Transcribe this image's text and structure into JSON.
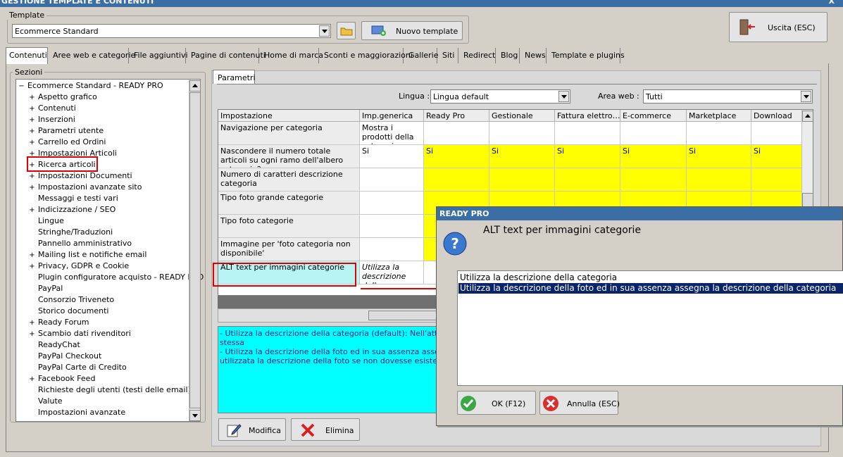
{
  "window": {
    "title": "GESTIONE TEMPLATE E CONTENUTI",
    "close": "X"
  },
  "template": {
    "group_label": "Template",
    "selected": "Ecommerce Standard",
    "new_button": "Nuovo template"
  },
  "exit_button": "Uscita (ESC)",
  "tabs": [
    "Contenuti",
    "Aree web e categorie",
    "File aggiuntivi",
    "Pagine di contenuti",
    "Home di marca",
    "Sconti e maggiorazioni",
    "Gallerie",
    "Siti",
    "Redirect",
    "Blog",
    "News",
    "Template e plugins"
  ],
  "sections": {
    "label": "Sezioni",
    "root": "Ecommerce Standard - READY PRO",
    "items": [
      {
        "label": "Aspetto grafico",
        "exp": "+"
      },
      {
        "label": "Contenuti",
        "exp": "+"
      },
      {
        "label": "Inserzioni",
        "exp": "+"
      },
      {
        "label": "Parametri utente",
        "exp": "+"
      },
      {
        "label": "Carrello ed Ordini",
        "exp": "+"
      },
      {
        "label": "Impostazioni Articoli",
        "exp": "+"
      },
      {
        "label": "Ricerca articoli",
        "exp": "+"
      },
      {
        "label": "Impostazioni Documenti",
        "exp": "+"
      },
      {
        "label": "Impostazioni avanzate sito",
        "exp": "+"
      },
      {
        "label": "Messaggi e testi vari",
        "exp": ""
      },
      {
        "label": "Indicizzazione / SEO",
        "exp": "+"
      },
      {
        "label": "Lingue",
        "exp": ""
      },
      {
        "label": "Stringhe/Traduzioni",
        "exp": ""
      },
      {
        "label": "Pannello amministrativo",
        "exp": ""
      },
      {
        "label": "Mailing list e notifiche email",
        "exp": "+"
      },
      {
        "label": "Privacy, GDPR e Cookie",
        "exp": "+"
      },
      {
        "label": "Plugin configuratore acquisto - READY PRO",
        "exp": ""
      },
      {
        "label": "PayPal",
        "exp": ""
      },
      {
        "label": "Consorzio Triveneto",
        "exp": ""
      },
      {
        "label": "Storico documenti",
        "exp": ""
      },
      {
        "label": "Ready Forum",
        "exp": "+"
      },
      {
        "label": "Scambio dati rivenditori",
        "exp": "+"
      },
      {
        "label": "ReadyChat",
        "exp": ""
      },
      {
        "label": "PayPal Checkout",
        "exp": ""
      },
      {
        "label": "PayPal Carte di Credito",
        "exp": ""
      },
      {
        "label": "Facebook Feed",
        "exp": "+"
      },
      {
        "label": "Richieste degli utenti (testi delle email)",
        "exp": ""
      },
      {
        "label": "Valute",
        "exp": ""
      },
      {
        "label": "Impostazioni avanzate",
        "exp": ""
      }
    ]
  },
  "params": {
    "tab": "Parametri",
    "lingua_label": "Lingua :",
    "lingua_value": "Lingua default",
    "area_label": "Area web :",
    "area_value": "Tutti",
    "columns": [
      "Impostazione",
      "Imp.generica",
      "Ready Pro",
      "Gestionale",
      "Fattura elettro…",
      "E-commerce",
      "Marketplace",
      "Download"
    ],
    "rows": [
      {
        "setting": "Navigazione per categoria",
        "generic": "Mostra i prodotti della categoria …",
        "vals": [
          "",
          "",
          "",
          "",
          "",
          ""
        ],
        "yellow": false
      },
      {
        "setting": "Nascondere il numero totale articoli su ogni ramo dell'albero categorie?",
        "generic": "Si",
        "vals": [
          "Si",
          "Si",
          "Si",
          "Si",
          "Si",
          "Si"
        ],
        "yellow": true
      },
      {
        "setting": "Numero di caratteri descrizione categoria",
        "generic": "",
        "vals": [
          "",
          "",
          "",
          "",
          "",
          ""
        ],
        "yellow": true
      },
      {
        "setting": "Tipo foto grande categorie",
        "generic": "",
        "vals": [
          "",
          "",
          "",
          "",
          "",
          ""
        ],
        "yellow": true
      },
      {
        "setting": "Tipo foto categorie",
        "generic": "",
        "vals": [
          "",
          "",
          "",
          "",
          "",
          ""
        ],
        "yellow": true
      },
      {
        "setting": "Immagine per 'foto categoria non disponibile'",
        "generic": "",
        "vals": [
          "",
          "",
          "",
          "",
          "",
          ""
        ],
        "yellow": true
      },
      {
        "setting": "ALT text per immagini categorie",
        "generic": "Utilizza la descrizione dell…",
        "vals": [
          "",
          "",
          "",
          "",
          "",
          ""
        ],
        "yellow": false
      }
    ],
    "description_lines": [
      "- Utilizza la descrizione della categoria (default): Nell'attributo Alt",
      "stessa",
      "- Utilizza la descrizione della foto ed in sua assenza assegna la de",
      "utilizzata la descrizione della foto se non dovesse esistere verra'"
    ],
    "edit_button": "Modifica",
    "delete_button": "Elimina"
  },
  "dialog": {
    "title": "READY PRO",
    "question": "ALT text per immagini categorie",
    "options": [
      "Utilizza la descrizione della categoria",
      "Utilizza la descrizione della foto ed in sua assenza assegna la descrizione della categoria"
    ],
    "selected_index": 1,
    "ok": "OK (F12)",
    "cancel": "Annulla (ESC)"
  },
  "colors": {
    "highlight_red": "#e00000",
    "yellow": "#ffff00",
    "cyan": "#00ffff",
    "row_selected": "#b8f4f4",
    "selection": "#0a246a"
  }
}
